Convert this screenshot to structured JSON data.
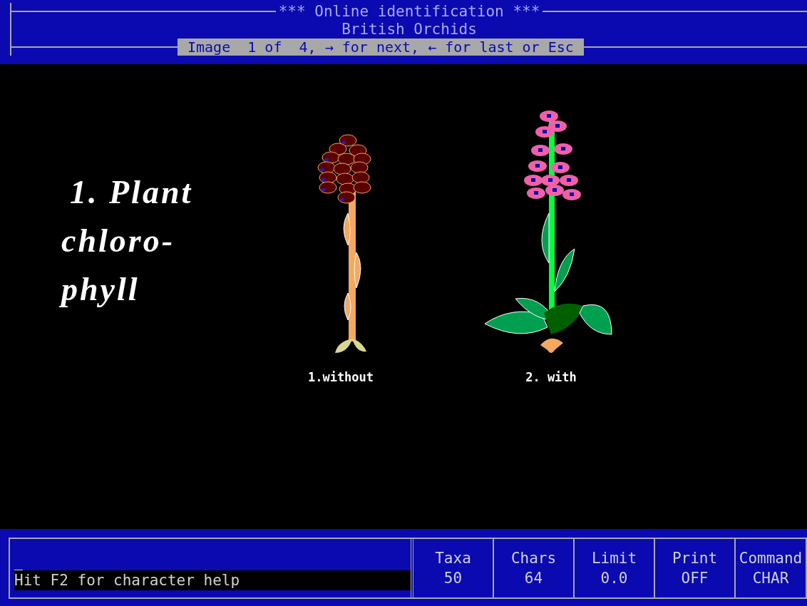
{
  "header": {
    "title": "*** Online identification ***",
    "subtitle": "British Orchids",
    "navigation_hint": "Image  1 of  4, → for next, ← for last or Esc"
  },
  "character": {
    "heading_lines": [
      "1. Plant",
      "chloro-",
      "phyll"
    ],
    "states": [
      {
        "kind": "without",
        "label": "1.without"
      },
      {
        "kind": "with",
        "label": "2. with"
      }
    ]
  },
  "command_line": {
    "cursor": "_",
    "message": "Hit F2 for character help"
  },
  "status": [
    {
      "label": "Taxa",
      "value": "50"
    },
    {
      "label": "Chars",
      "value": "64"
    },
    {
      "label": "Limit",
      "value": "0.0"
    },
    {
      "label": "Print",
      "value": "OFF"
    },
    {
      "label": "Command",
      "value": "CHAR"
    }
  ]
}
